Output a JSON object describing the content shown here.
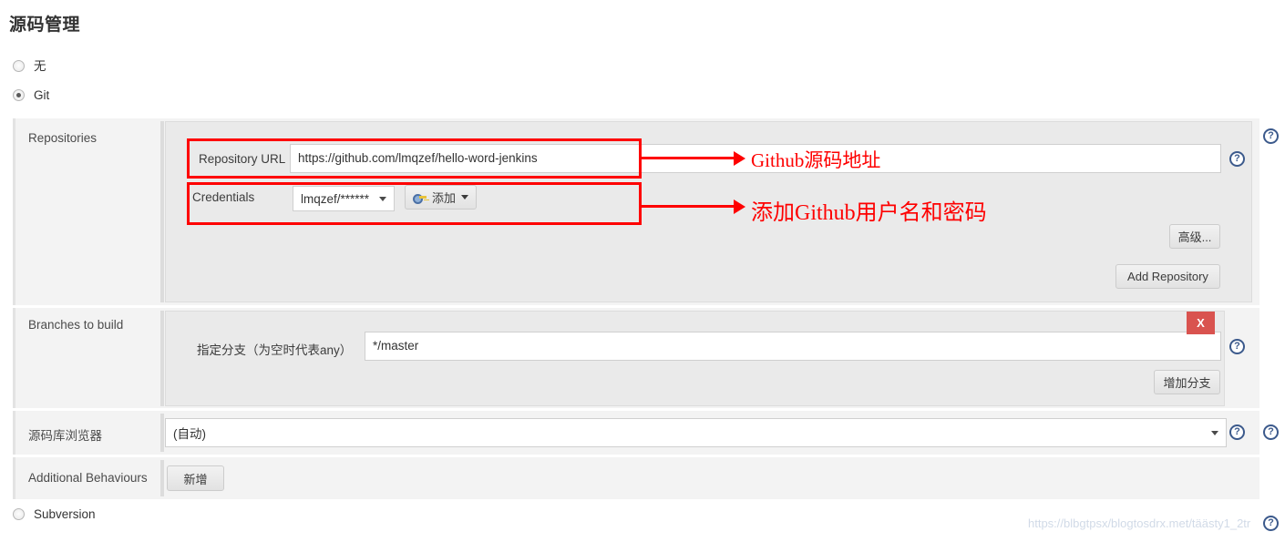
{
  "page": {
    "title": "源码管理"
  },
  "scm_options": [
    {
      "label": "无",
      "selected": false
    },
    {
      "label": "Git",
      "selected": true
    },
    {
      "label": "Subversion",
      "selected": false
    }
  ],
  "sections": {
    "repositories": {
      "label": "Repositories",
      "repository_url": {
        "label": "Repository URL",
        "value": "https://github.com/lmqzef/hello-word-jenkins",
        "placeholder": ""
      },
      "credentials": {
        "label": "Credentials",
        "selected": "lmqzef/******",
        "add_button": "添加",
        "add_icon": "key-icon"
      },
      "advanced_button": "高级...",
      "add_repository_button": "Add Repository"
    },
    "branches": {
      "label": "Branches to build",
      "branch_spec": {
        "label": "指定分支（为空时代表any）",
        "value": "*/master",
        "placeholder": ""
      },
      "delete_button": "X",
      "add_branch_button": "增加分支"
    },
    "browser": {
      "label": "源码库浏览器",
      "selected": "(自动)"
    },
    "additional_behaviours": {
      "label": "Additional Behaviours",
      "add_button": "新增"
    }
  },
  "annotations": [
    {
      "text": "Github源码地址"
    },
    {
      "text": "添加Github用户名和密码"
    }
  ],
  "help_icon": "?",
  "watermark": "https://blbgtpsx/blogtosdrx.met/täästy1_2tr",
  "colors": {
    "annotation_red": "#fe0000",
    "delete_red": "#d9534f",
    "help_blue": "#3c5a8c",
    "panel_bg": "#eaeaea",
    "section_bg": "#f3f3f3"
  }
}
